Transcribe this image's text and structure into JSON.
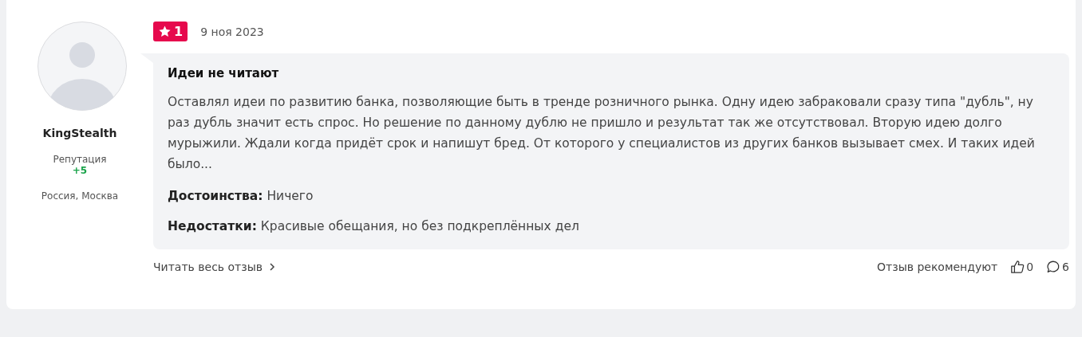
{
  "author": {
    "name": "KingStealth",
    "reputation_label": "Репутация",
    "reputation": "+5",
    "location": "Россия, Москва"
  },
  "review": {
    "rating": "1",
    "date": "9 ноя 2023",
    "title": "Идеи не читают",
    "text": "Оставлял идеи по развитию банка, позволяющие быть в тренде розничного рынка. Одну идею забраковали сразу типа \"дубль\", ну раз дубль значит есть спрос. Но решение по данному дублю не пришло и результат так же отсутствовал. Вторую идею долго мурыжили. Ждали когда придёт срок и напишут бред. От которого у специалистов из других банков вызывает смех. И таких идей было...",
    "sections": [
      {
        "label": "Достоинства:",
        "text": "Ничего"
      },
      {
        "label": "Недостатки:",
        "text": "Красивые обещания, но без подкреплённых дел"
      }
    ]
  },
  "footer": {
    "read_more": "Читать весь отзыв",
    "recommend_label": "Отзыв рекомендуют",
    "likes": "0",
    "comments": "6"
  }
}
